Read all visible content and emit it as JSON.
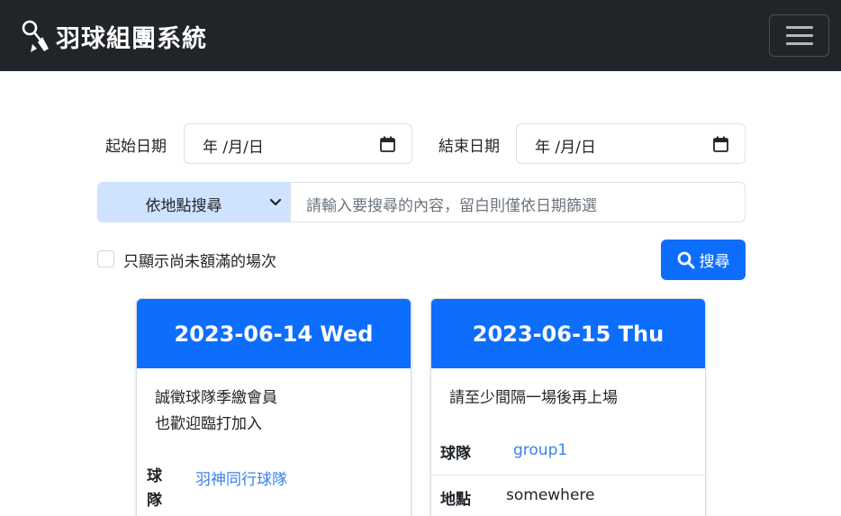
{
  "navbar": {
    "brand_icon": "badminton-shuttlecock-icon",
    "title": "羽球組團系統",
    "menu_icon": "hamburger-menu-icon"
  },
  "filters": {
    "start_label": "起始日期",
    "start_value": "年 /月/日",
    "end_label": "結束日期",
    "end_value": "年 /月/日",
    "search_mode": "依地點搜尋",
    "search_placeholder": "請輸入要搜尋的內容，留白則僅依日期篩選",
    "only_open_label": "只顯示尚未額滿的場次",
    "search_button": "搜尋"
  },
  "cards": [
    {
      "title": "2023-06-14 Wed",
      "note_lines": [
        "誠徵球隊季繳會員",
        "也歡迎臨打加入"
      ],
      "team_label_line1": "球",
      "team_label_line2": "隊",
      "team_name": "羽神同行球隊"
    },
    {
      "title": "2023-06-15 Thu",
      "note_lines": [
        "請至少間隔一場後再上場"
      ],
      "team_label": "球隊",
      "team_name": "group1",
      "location_label": "地點",
      "location_value": "somewhere"
    }
  ],
  "colors": {
    "navbar": "#212529",
    "primary": "#0d6efd",
    "select_bg": "#cfe2ff",
    "link": "#3b82e6"
  }
}
